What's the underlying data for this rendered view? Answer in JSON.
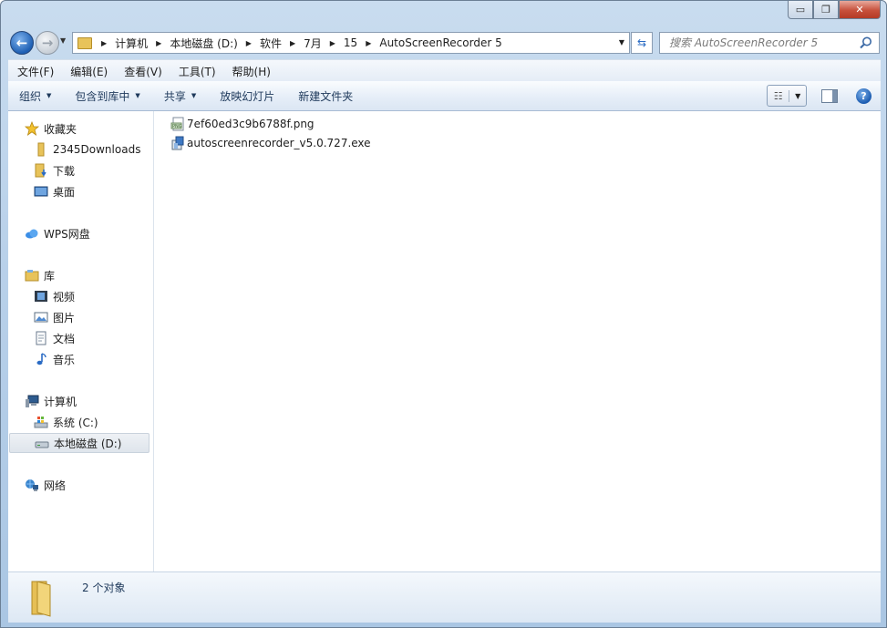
{
  "window": {
    "caption": {
      "minimize": "▭",
      "maximize": "❐",
      "close": "✕"
    }
  },
  "address": {
    "crumbs": [
      "计算机",
      "本地磁盘 (D:)",
      "软件",
      "7月",
      "15",
      "AutoScreenRecorder 5"
    ]
  },
  "search": {
    "placeholder": "搜索 AutoScreenRecorder 5"
  },
  "menu": [
    "文件(F)",
    "编辑(E)",
    "查看(V)",
    "工具(T)",
    "帮助(H)"
  ],
  "commands": {
    "organize": "组织",
    "include_library": "包含到库中",
    "share": "共享",
    "slideshow": "放映幻灯片",
    "new_folder": "新建文件夹"
  },
  "nav": {
    "favorites": "收藏夹",
    "favorites_items": [
      "2345Downloads",
      "下载",
      "桌面"
    ],
    "wps": "WPS网盘",
    "libraries": "库",
    "library_items": [
      "视频",
      "图片",
      "文档",
      "音乐"
    ],
    "computer": "计算机",
    "computer_items": [
      "系统 (C:)",
      "本地磁盘 (D:)"
    ],
    "network": "网络"
  },
  "files": [
    {
      "name": "7ef60ed3c9b6788f.png",
      "icon": "png-file-icon"
    },
    {
      "name": "autoscreenrecorder_v5.0.727.exe",
      "icon": "installer-icon"
    }
  ],
  "status": {
    "count": "2 个对象"
  },
  "colors": {
    "accent": "#1e5fb3",
    "selected_bg": "#dfe5ec",
    "command_text": "#1e395b"
  }
}
